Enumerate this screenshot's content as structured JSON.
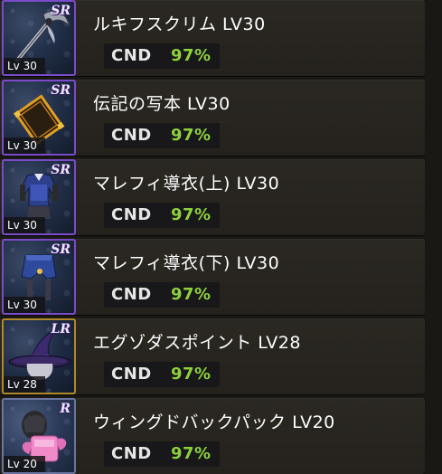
{
  "equipment_list": {
    "cnd_label": "CND",
    "items": [
      {
        "name": "ルキフスクリム LV30",
        "rarity": "SR",
        "level_badge": "Lv 30",
        "cnd": "97%",
        "icon": "scythe-icon"
      },
      {
        "name": "伝記の写本 LV30",
        "rarity": "SR",
        "level_badge": "Lv 30",
        "cnd": "97%",
        "icon": "book-icon"
      },
      {
        "name": "マレフィ導衣(上) LV30",
        "rarity": "SR",
        "level_badge": "Lv 30",
        "cnd": "97%",
        "icon": "robe-top-icon"
      },
      {
        "name": "マレフィ導衣(下) LV30",
        "rarity": "SR",
        "level_badge": "Lv 30",
        "cnd": "97%",
        "icon": "robe-bottom-icon"
      },
      {
        "name": "エグゾダスポイント LV28",
        "rarity": "LR",
        "level_badge": "Lv 28",
        "cnd": "97%",
        "icon": "witch-hat-icon"
      },
      {
        "name": "ウィングドバックパック LV20",
        "rarity": "R",
        "level_badge": "Lv 20",
        "cnd": "97%",
        "icon": "backpack-icon"
      }
    ]
  },
  "colors": {
    "cnd_value": "#8ed23a",
    "sr_frame": "#7a4cc9",
    "lr_frame": "#b08a2a",
    "r_frame": "#6a76a0"
  }
}
